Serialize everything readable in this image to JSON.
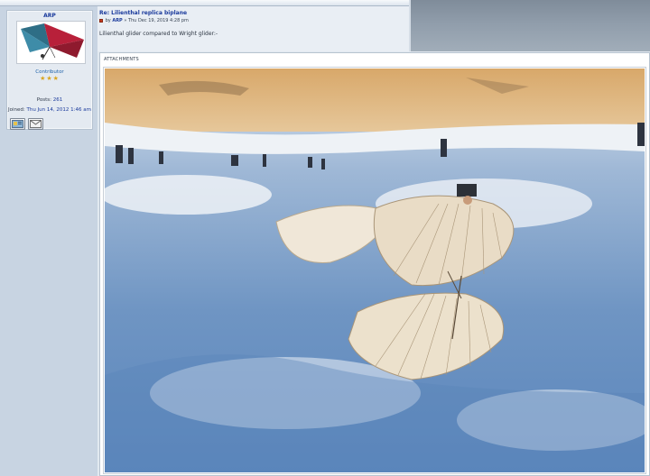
{
  "profile": {
    "username": "ARP",
    "rank": "Contributor",
    "stars": "★★★",
    "posts_label": "Posts:",
    "posts_value": "261",
    "joined_label": "Joined:",
    "joined_value": "Thu Jun 14, 2012 1:46 am"
  },
  "post": {
    "title": "Re: Lilienthal replica biplane",
    "by_label": "by",
    "author": "ARP",
    "date": "» Thu Dec 19, 2019 4:28 pm",
    "text": "Lilienthal glider compared to Wright glider:-"
  },
  "attachments": {
    "label": "ATTACHMENTS"
  },
  "icons": {
    "profile_button": "website-icon",
    "pm_button": "email-icon",
    "post_icon": "post-icon"
  },
  "colors": {
    "link": "#1a3a9c",
    "accent_header": "#8a97a5"
  }
}
